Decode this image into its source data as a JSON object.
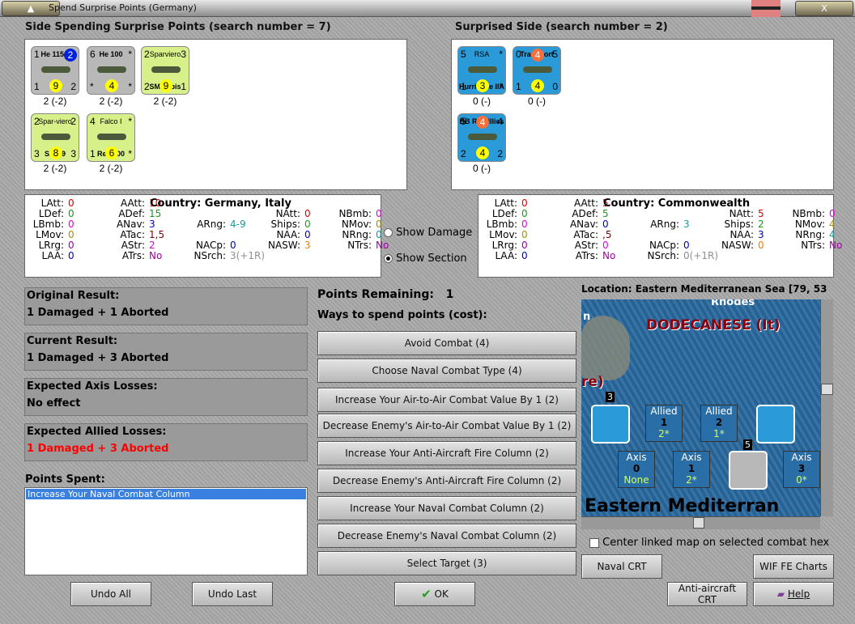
{
  "window": {
    "title": "Spend Surprise Points (Germany)",
    "min_label": "▲",
    "close_label": "X"
  },
  "left": {
    "header": "Side Spending Surprise Points (search number = 7)",
    "counters": [
      {
        "tl": "1",
        "tr": "2",
        "bl": "1",
        "br": "2",
        "name": "He 115C",
        "circle": "9",
        "circle_top": "2",
        "bg": "#b8b8b8",
        "caption": "2 (-2)"
      },
      {
        "tl": "6",
        "tr": "*",
        "bl": "*",
        "br": "*",
        "name": "He 100",
        "circle": "4",
        "bg": "#b8b8b8",
        "caption": "2 (-2)"
      },
      {
        "tl": "2",
        "tr": "3",
        "bl": "2",
        "br": "1",
        "name": "SM.79bis",
        "sub": "Sparviero",
        "circle": "9",
        "bg": "#d8f08a",
        "caption": "2 (-2)"
      },
      {
        "tl": "2",
        "tr": "2",
        "bl": "3",
        "br": "3",
        "name": "SM.79",
        "sub": "Spar-viero",
        "circle": "8",
        "bg": "#d8f08a",
        "caption": "2 (-2)"
      },
      {
        "tl": "4",
        "tr": "*",
        "bl": "1",
        "br": "*",
        "name": "Re.2000",
        "sub": "Falco I",
        "circle": "6",
        "bg": "#d8f08a",
        "caption": "2 (-2)"
      }
    ]
  },
  "right": {
    "header": "Surprised Side (search number = 2)",
    "counters": [
      {
        "tl": "5",
        "tr": "*",
        "bl": "1",
        "br": "*",
        "name": "Hurricane IIA",
        "sub": "RSA",
        "circle": "3",
        "bg": "#2a9ad8",
        "caption": "0 (-)"
      },
      {
        "tl": "0",
        "tr": "5",
        "bl": "1",
        "br": "0",
        "name": "Transport",
        "circle": "4",
        "circle_top": "4",
        "bg": "#2a9ad8",
        "caption": "0 (-)"
      },
      {
        "tl": "5",
        "tr": "4",
        "bl": "2",
        "br": "2",
        "name": "BB Ramillies",
        "circle": "4",
        "circle_top": "4",
        "bg": "#2a9ad8",
        "caption": "0 (-)"
      }
    ]
  },
  "stats_left": {
    "country": "Country: Germany, Italy",
    "items": [
      [
        "LAtt:",
        "0",
        "#e00000"
      ],
      [
        "LDef:",
        "0",
        "#1a9a1a"
      ],
      [
        "LBmb:",
        "0",
        "#e000e0"
      ],
      [
        "LMov:",
        "0",
        "#a09000"
      ],
      [
        "LRrg:",
        "0",
        "#a000a0"
      ],
      [
        "LAA:",
        "0",
        "#0000c0"
      ],
      [
        "AAtt:",
        "10",
        "#e00000"
      ],
      [
        "ADef:",
        "15",
        "#1a9a1a"
      ],
      [
        "ANav:",
        "3",
        "#0000c0"
      ],
      [
        "ATac:",
        "1,5",
        "#800000"
      ],
      [
        "AStr:",
        "2",
        "#e000e0"
      ],
      [
        "ATrs:",
        "No",
        "#a000a0"
      ],
      [
        "ARng:",
        "4-9",
        "#10a0a0"
      ],
      [
        "NACp:",
        "0",
        "#0000c0"
      ],
      [
        "NSrch:",
        "3(+1R)",
        "#909090"
      ],
      [
        "NAtt:",
        "0",
        "#e00000"
      ],
      [
        "Ships:",
        "0",
        "#1a9a1a"
      ],
      [
        "NAA:",
        "0",
        "#0000c0"
      ],
      [
        "NASW:",
        "3",
        "#f08000"
      ],
      [
        "NBmb:",
        "0",
        "#e000e0"
      ],
      [
        "NMov:",
        "0",
        "#a09000"
      ],
      [
        "NRng:",
        "0",
        "#10a0a0"
      ],
      [
        "NTrs:",
        "No",
        "#a000a0"
      ]
    ]
  },
  "stats_right": {
    "country": "Country: Commonwealth",
    "items": [
      [
        "LAtt:",
        "0",
        "#e00000"
      ],
      [
        "LDef:",
        "0",
        "#1a9a1a"
      ],
      [
        "LBmb:",
        "0",
        "#e000e0"
      ],
      [
        "LMov:",
        "0",
        "#a09000"
      ],
      [
        "LRrg:",
        "0",
        "#a000a0"
      ],
      [
        "LAA:",
        "0",
        "#0000c0"
      ],
      [
        "AAtt:",
        "5",
        "#e00000"
      ],
      [
        "ADef:",
        "5",
        "#1a9a1a"
      ],
      [
        "ANav:",
        "0",
        "#0000c0"
      ],
      [
        "ATac:",
        ",5",
        "#800000"
      ],
      [
        "AStr:",
        "0",
        "#e000e0"
      ],
      [
        "ATrs:",
        "No",
        "#a000a0"
      ],
      [
        "ARng:",
        "3",
        "#10a0a0"
      ],
      [
        "NACp:",
        "0",
        "#0000c0"
      ],
      [
        "NSrch:",
        "0(+1R)",
        "#909090"
      ],
      [
        "NAtt:",
        "5",
        "#e00000"
      ],
      [
        "Ships:",
        "2",
        "#1a9a1a"
      ],
      [
        "NAA:",
        "3",
        "#0000c0"
      ],
      [
        "NASW:",
        "0",
        "#f08000"
      ],
      [
        "NBmb:",
        "0",
        "#e000e0"
      ],
      [
        "NMov:",
        "4",
        "#a09000"
      ],
      [
        "NRng:",
        "4",
        "#10a0a0"
      ],
      [
        "NTrs:",
        "No",
        "#a000a0"
      ]
    ]
  },
  "radios": {
    "show_damage": "Show Damage",
    "show_section": "Show Section",
    "selected": "show_section"
  },
  "results": [
    {
      "label": "Original Result:",
      "value": "1 Damaged + 1 Aborted",
      "color": "#000000"
    },
    {
      "label": "Current Result:",
      "value": "1 Damaged + 3 Aborted",
      "color": "#000000"
    },
    {
      "label": "Expected Axis Losses:",
      "value": "No effect",
      "color": "#000000"
    },
    {
      "label": "Expected Allied Losses:",
      "value": "1 Damaged + 3 Aborted",
      "color": "#ff0000"
    }
  ],
  "points_spent": {
    "label": "Points Spent:",
    "items": [
      "Increase Your Naval Combat Column"
    ]
  },
  "middle": {
    "points_label": "Points Remaining:",
    "points_value": "1",
    "ways_label": "Ways to spend points (cost):",
    "options": [
      "Avoid Combat (4)",
      "Choose Naval Combat Type (4)",
      "Increase Your Air-to-Air Combat Value By 1 (2)",
      "Decrease Enemy's Air-to-Air Combat Value By 1 (2)",
      "Increase Your Anti-Aircraft Fire Column (2)",
      "Decrease Enemy's Anti-Aircraft Fire Column (2)",
      "Increase Your Naval Combat Column (2)",
      "Decrease Enemy's Naval Combat Column (2)",
      "Select Target (3)"
    ]
  },
  "map": {
    "location": "Location: Eastern Mediterranean Sea [79, 53",
    "labels": {
      "rhodes": "Rhodes",
      "dodecanese": "DODECANESE (It)",
      "re": "re)",
      "sea": "Eastern Mediterran",
      "n": "n"
    },
    "boxes": [
      {
        "side": "Allied",
        "num": "1",
        "val": "2*"
      },
      {
        "side": "Allied",
        "num": "2",
        "val": "1*"
      },
      {
        "side": "Axis",
        "num": "0",
        "val": "None"
      },
      {
        "side": "Axis",
        "num": "1",
        "val": "2*"
      },
      {
        "side": "Axis",
        "num": "3",
        "val": "0*"
      }
    ],
    "stack_labels": [
      "3",
      "5"
    ],
    "checkbox_label": "Center linked map on selected combat hex",
    "checked": false
  },
  "buttons": {
    "naval_crt": "Naval CRT",
    "wif_charts": "WIF FE Charts",
    "aa_crt": "Anti-aircraft CRT",
    "help": "Help",
    "undo_all": "Undo All",
    "undo_last": "Undo Last",
    "ok": "OK"
  }
}
